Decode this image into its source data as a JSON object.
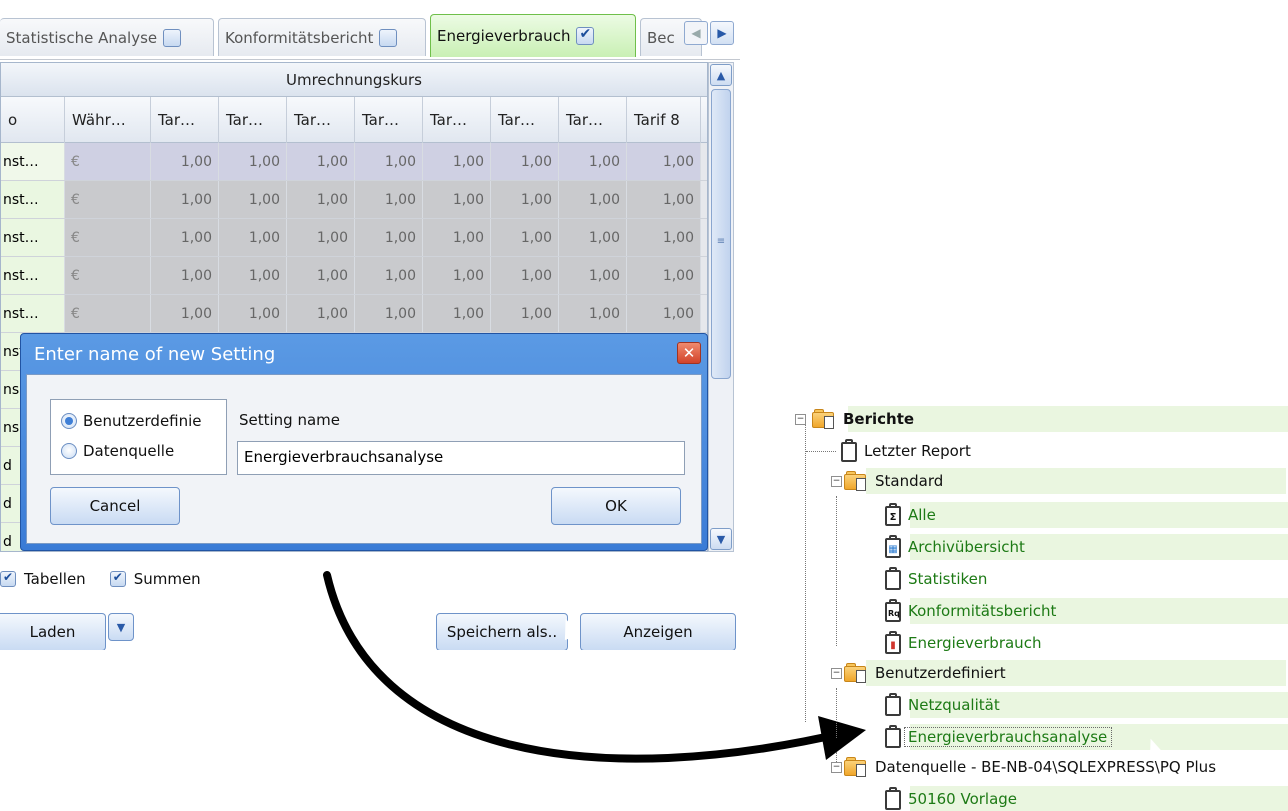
{
  "tabs": [
    {
      "label": "Statistische Analyse",
      "checked": false
    },
    {
      "label": "Konformitätsbericht",
      "checked": false
    },
    {
      "label": "Energieverbrauch",
      "checked": true,
      "active": true
    },
    {
      "label": "Bec"
    }
  ],
  "grid": {
    "group_header": "Umrechnungskurs",
    "columns": [
      "Währ…",
      "Tar…",
      "Tar…",
      "Tar…",
      "Tar…",
      "Tar…",
      "Tar…",
      "Tar…",
      "Tarif 8"
    ],
    "first_col_header": "o",
    "rows": [
      {
        "name": "nst…",
        "currency": "€",
        "values": [
          "1,00",
          "1,00",
          "1,00",
          "1,00",
          "1,00",
          "1,00",
          "1,00",
          "1,00"
        ],
        "selected": true
      },
      {
        "name": "nst…",
        "currency": "€",
        "values": [
          "1,00",
          "1,00",
          "1,00",
          "1,00",
          "1,00",
          "1,00",
          "1,00",
          "1,00"
        ]
      },
      {
        "name": "nst…",
        "currency": "€",
        "values": [
          "1,00",
          "1,00",
          "1,00",
          "1,00",
          "1,00",
          "1,00",
          "1,00",
          "1,00"
        ]
      },
      {
        "name": "nst…",
        "currency": "€",
        "values": [
          "1,00",
          "1,00",
          "1,00",
          "1,00",
          "1,00",
          "1,00",
          "1,00",
          "1,00"
        ]
      },
      {
        "name": "nst…",
        "currency": "€",
        "values": [
          "1,00",
          "1,00",
          "1,00",
          "1,00",
          "1,00",
          "1,00",
          "1,00",
          "1,00"
        ]
      },
      {
        "name": "nst",
        "currency": "",
        "values": [
          "",
          "",
          "",
          "",
          "",
          "",
          "",
          ""
        ]
      },
      {
        "name": "ns",
        "currency": "",
        "values": [
          "",
          "",
          "",
          "",
          "",
          "",
          "",
          ""
        ]
      },
      {
        "name": "ns",
        "currency": "",
        "values": [
          "",
          "",
          "",
          "",
          "",
          "",
          "",
          ""
        ]
      },
      {
        "name": "d",
        "currency": "",
        "values": [
          "",
          "",
          "",
          "",
          "",
          "",
          "",
          ""
        ]
      },
      {
        "name": "d",
        "currency": "",
        "values": [
          "",
          "",
          "",
          "",
          "",
          "",
          "",
          ""
        ]
      },
      {
        "name": "d",
        "currency": "",
        "values": [
          "",
          "",
          "",
          "",
          "",
          "",
          "",
          ""
        ]
      }
    ]
  },
  "options": {
    "tables_label": "Tabellen",
    "sums_label": "Summen"
  },
  "buttons": {
    "load": "Laden",
    "save_as": "Speichern als..",
    "show": "Anzeigen"
  },
  "dialog": {
    "title": "Enter name of new Setting",
    "close_glyph": "✕",
    "radio_user": "Benutzerdefinie",
    "radio_source": "Datenquelle",
    "setting_name_label": "Setting name",
    "setting_name_value": "Energieverbrauchsanalyse",
    "cancel": "Cancel",
    "ok": "OK"
  },
  "tree": {
    "root": "Berichte",
    "last_report": "Letzter Report",
    "standard": "Standard",
    "standard_items": [
      "Alle",
      "Archivübersicht",
      "Statistiken",
      "Konformitätsbericht",
      "Energieverbrauch"
    ],
    "user_defined": "Benutzerdefiniert",
    "user_items": [
      "Netzqualität",
      "Energieverbrauchsanalyse"
    ],
    "datasource": "Datenquelle - BE-NB-04\\SQLEXPRESS\\PQ Plus",
    "datasource_items": [
      "50160 Vorlage"
    ]
  },
  "colors": {
    "accent": "#3a7bd6",
    "highlight": "#eaf6e0",
    "tree_green": "#1d7a15"
  }
}
